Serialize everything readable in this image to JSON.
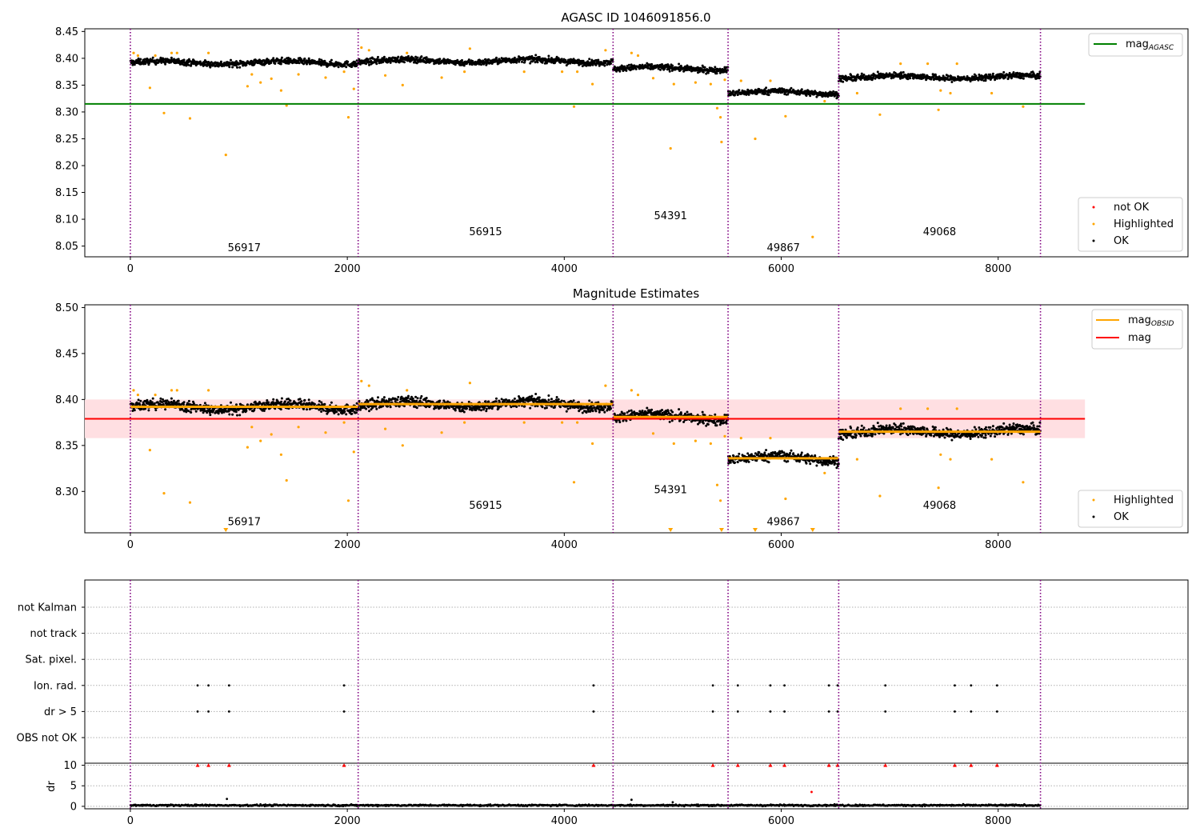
{
  "chart_data": [
    {
      "type": "scatter",
      "title": "AGASC ID 1046091856.0",
      "xlim": [
        -420,
        9750
      ],
      "ylim": [
        8.03,
        8.455
      ],
      "x_ticks": [
        "0",
        "2000",
        "4000",
        "6000",
        "8000"
      ],
      "y_ticks": [
        "8.05",
        "8.10",
        "8.15",
        "8.20",
        "8.25",
        "8.30",
        "8.35",
        "8.40",
        "8.45"
      ],
      "obs_boundaries": [
        0,
        2100,
        4450,
        5510,
        6530,
        8390
      ],
      "observations": [
        {
          "obsid": "56917",
          "x_start": 0,
          "x_end": 2100,
          "mean": 8.392,
          "label_x": 1050,
          "label_y": 8.047
        },
        {
          "obsid": "56915",
          "x_start": 2100,
          "x_end": 4450,
          "mean": 8.395,
          "label_x": 3275,
          "label_y": 8.077
        },
        {
          "obsid": "54391",
          "x_start": 4450,
          "x_end": 5510,
          "mean": 8.381,
          "label_x": 4980,
          "label_y": 8.107
        },
        {
          "obsid": "49867",
          "x_start": 5510,
          "x_end": 6530,
          "mean": 8.336,
          "label_x": 6020,
          "label_y": 8.047
        },
        {
          "obsid": "49068",
          "x_start": 6530,
          "x_end": 8390,
          "mean": 8.365,
          "label_x": 7460,
          "label_y": 8.077
        }
      ],
      "mag_agasc": 8.315,
      "mag_agasc_x_range": [
        -420,
        8800
      ],
      "highlighted_points": [
        [
          30,
          8.41
        ],
        [
          70,
          8.405
        ],
        [
          180,
          8.345
        ],
        [
          230,
          8.405
        ],
        [
          310,
          8.298
        ],
        [
          380,
          8.41
        ],
        [
          430,
          8.41
        ],
        [
          550,
          8.288
        ],
        [
          720,
          8.41
        ],
        [
          880,
          8.22
        ],
        [
          1080,
          8.348
        ],
        [
          1120,
          8.37
        ],
        [
          1200,
          8.355
        ],
        [
          1300,
          8.362
        ],
        [
          1390,
          8.34
        ],
        [
          1440,
          8.312
        ],
        [
          1550,
          8.37
        ],
        [
          1800,
          8.364
        ],
        [
          1970,
          8.375
        ],
        [
          2010,
          8.29
        ],
        [
          2060,
          8.343
        ],
        [
          2130,
          8.42
        ],
        [
          2200,
          8.415
        ],
        [
          2350,
          8.368
        ],
        [
          2510,
          8.35
        ],
        [
          2550,
          8.41
        ],
        [
          2870,
          8.364
        ],
        [
          3080,
          8.375
        ],
        [
          3130,
          8.418
        ],
        [
          3630,
          8.375
        ],
        [
          3980,
          8.375
        ],
        [
          4090,
          8.31
        ],
        [
          4120,
          8.375
        ],
        [
          4260,
          8.352
        ],
        [
          4380,
          8.415
        ],
        [
          4620,
          8.41
        ],
        [
          4680,
          8.405
        ],
        [
          4820,
          8.363
        ],
        [
          4980,
          8.232
        ],
        [
          5010,
          8.352
        ],
        [
          5210,
          8.355
        ],
        [
          5350,
          8.352
        ],
        [
          5410,
          8.307
        ],
        [
          5440,
          8.29
        ],
        [
          5450,
          8.244
        ],
        [
          5480,
          8.36
        ],
        [
          5630,
          8.358
        ],
        [
          5760,
          8.25
        ],
        [
          5900,
          8.358
        ],
        [
          6040,
          8.292
        ],
        [
          6290,
          8.067
        ],
        [
          6400,
          8.32
        ],
        [
          6700,
          8.335
        ],
        [
          6910,
          8.295
        ],
        [
          7100,
          8.39
        ],
        [
          7350,
          8.39
        ],
        [
          7450,
          8.304
        ],
        [
          7470,
          8.34
        ],
        [
          7560,
          8.335
        ],
        [
          7620,
          8.39
        ],
        [
          7940,
          8.335
        ],
        [
          8230,
          8.31
        ]
      ],
      "not_ok_points": [],
      "legend_top": [
        "mag_AGASC"
      ],
      "legend_bottom": [
        "not OK",
        "Highlighted",
        "OK"
      ],
      "legend_top_location": "upper right",
      "legend_bottom_location": "lower right",
      "colors": {
        "ok": "#000000",
        "highlighted": "#ffa500",
        "not_ok": "#ff0000",
        "agasc_line": "#008000",
        "boundary": "#800080"
      }
    },
    {
      "type": "scatter",
      "title": "Magnitude Estimates",
      "xlim": [
        -420,
        9750
      ],
      "ylim": [
        8.255,
        8.503
      ],
      "x_ticks": [
        "0",
        "2000",
        "4000",
        "6000",
        "8000"
      ],
      "y_ticks": [
        "8.30",
        "8.35",
        "8.40",
        "8.45",
        "8.50"
      ],
      "mag": 8.379,
      "mag_band": [
        8.358,
        8.4
      ],
      "mag_x_range": [
        -420,
        8800
      ],
      "clipped_low_points_x": [
        880,
        4980,
        5450,
        5760,
        6290
      ],
      "label_y": [
        8.267,
        8.285,
        8.302,
        8.267,
        8.285
      ],
      "legend_top": [
        "mag_OBSID",
        "mag"
      ],
      "legend_bottom": [
        "Highlighted",
        "OK"
      ],
      "colors": {
        "mag_obsid": "#ffa500",
        "mag": "#ff0000",
        "mag_band": "#ffdfe2"
      }
    },
    {
      "type": "scatter",
      "title": "",
      "categories": [
        "not Kalman",
        "not track",
        "Sat. pixel.",
        "Ion. rad.",
        "dr > 5",
        "OBS not OK"
      ],
      "flagged_points": {
        "Ion. rad.": [
          620,
          720,
          910,
          1970,
          4270,
          5370,
          5600,
          5900,
          6030,
          6440,
          6520,
          6960,
          7600,
          7750,
          7990
        ],
        "dr > 5": [
          620,
          720,
          910,
          1970,
          4270,
          5370,
          5600,
          5900,
          6030,
          6440,
          6520,
          6960,
          7600,
          7750,
          7990
        ]
      },
      "dr_panel": {
        "ylabel": "dr",
        "y_ticks": [
          "0",
          "5",
          "10"
        ],
        "ylim": [
          -0.6,
          10.5
        ],
        "capped_points_x": [
          620,
          720,
          910,
          1970,
          4270,
          5370,
          5600,
          5900,
          6030,
          6440,
          6520,
          6960,
          7600,
          7750,
          7990
        ],
        "other_high_points": [
          [
            6280,
            3.5
          ],
          [
            890,
            1.8
          ],
          [
            4620,
            1.6
          ],
          [
            5000,
            1.0
          ]
        ],
        "baseline": 0.25
      },
      "x_ticks": [
        "0",
        "2000",
        "4000",
        "6000",
        "8000"
      ]
    }
  ]
}
